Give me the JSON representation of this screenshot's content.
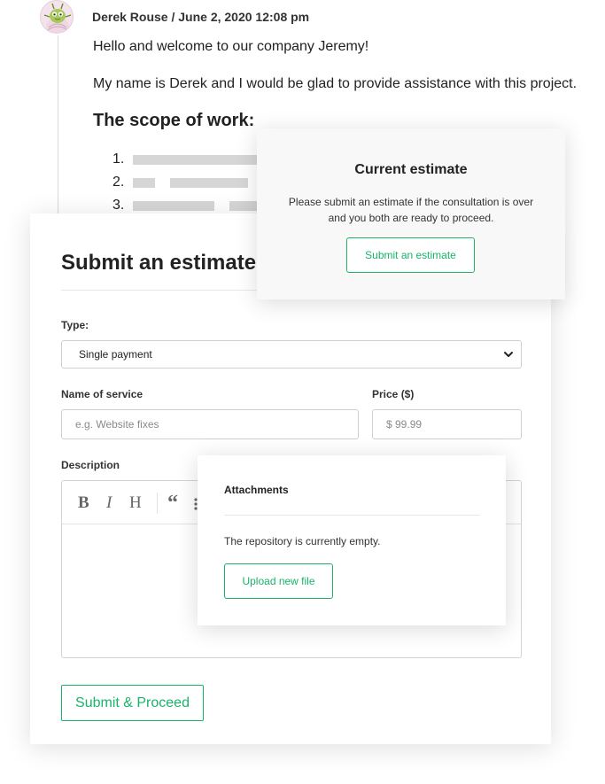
{
  "message": {
    "author_line": "Derek Rouse / June 2, 2020 12:08 pm",
    "greeting": "Hello and welcome to our company Jeremy!",
    "intro": "My name is Derek and I would be glad to provide assistance with this project.",
    "scope_title": "The scope of work:",
    "scope_items": [
      {
        "number": "1."
      },
      {
        "number": "2."
      },
      {
        "number": "3."
      }
    ]
  },
  "current_estimate": {
    "title": "Current estimate",
    "description": "Please submit an estimate if the consultation is over and you both are ready to proceed.",
    "button_label": "Submit an estimate"
  },
  "estimate_form": {
    "title": "Submit an estimate",
    "type_label": "Type:",
    "type_value": "Single payment",
    "service_label": "Name of service",
    "service_placeholder": "e.g. Website fixes",
    "price_label": "Price ($)",
    "price_placeholder": "$ 99.99",
    "description_label": "Description",
    "toolbar": {
      "bold": "B",
      "italic": "I",
      "heading": "H",
      "quote": "“"
    },
    "submit_label": "Submit & Proceed"
  },
  "attachments": {
    "title": "Attachments",
    "empty_text": "The repository is currently empty.",
    "upload_label": "Upload new file"
  },
  "colors": {
    "accent": "#19b46a",
    "placeholder_bar": "#d6d6d6",
    "card_bg": "#f8f8f8"
  },
  "icons": {
    "avatar": "bug-avatar-icon",
    "select_arrow": "chevron-down-icon",
    "quote": "quote-icon",
    "list": "list-icon"
  }
}
